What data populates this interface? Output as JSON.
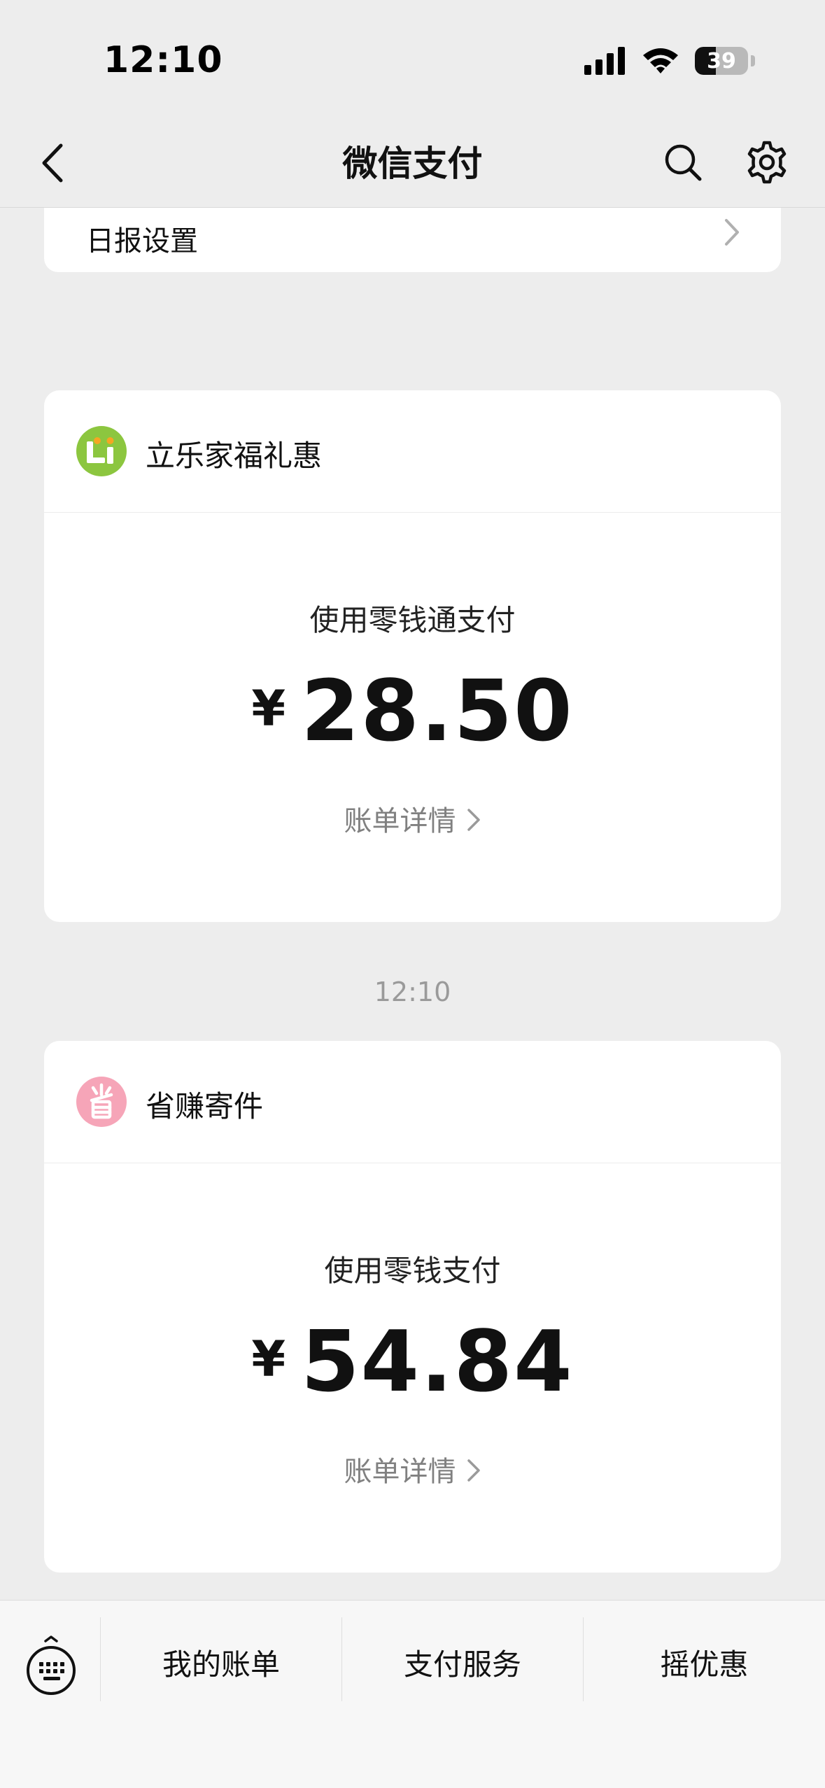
{
  "status_bar": {
    "time": "12:10",
    "battery_level": "39"
  },
  "nav": {
    "title": "微信支付",
    "icons": [
      "back-icon",
      "search-icon",
      "gear-icon"
    ]
  },
  "settings_row": {
    "label": "日报设置"
  },
  "payments": [
    {
      "merchant": "立乐家福礼惠",
      "logo": "lexiaojia-logo",
      "method": "使用零钱通支付",
      "currency": "¥",
      "amount": "28.50",
      "detail_link": "账单详情"
    },
    {
      "merchant": "省赚寄件",
      "logo": "shengzhuan-logo",
      "method": "使用零钱支付",
      "currency": "¥",
      "amount": "54.84",
      "detail_link": "账单详情"
    }
  ],
  "timestamp": "12:10",
  "bottom_menu": {
    "items": [
      "我的账单",
      "支付服务",
      "摇优惠"
    ],
    "icon": "keyboard-icon"
  },
  "colors": {
    "background": "#ededed",
    "card": "#ffffff",
    "logo_green": "#8cc63f",
    "logo_pink": "#f6a5b8",
    "muted_text": "#808080"
  }
}
